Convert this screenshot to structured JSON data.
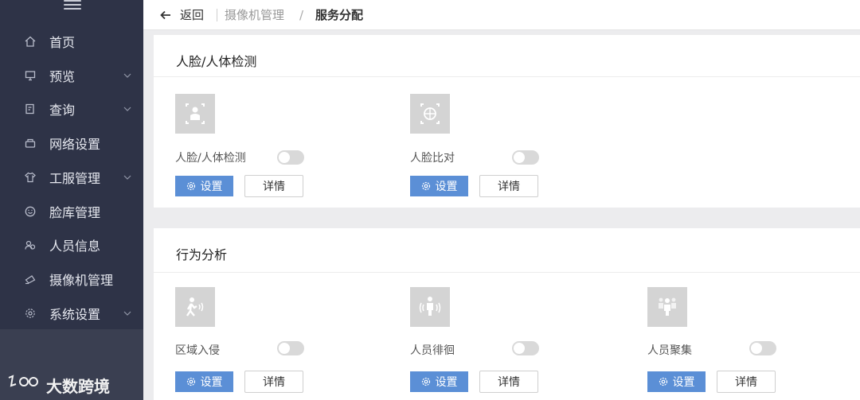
{
  "sidebar": {
    "items": [
      {
        "label": "首页",
        "icon": "home-icon",
        "expandable": false
      },
      {
        "label": "预览",
        "icon": "monitor-icon",
        "expandable": true
      },
      {
        "label": "查询",
        "icon": "document-search-icon",
        "expandable": true
      },
      {
        "label": "网络设置",
        "icon": "network-icon",
        "expandable": false
      },
      {
        "label": "工服管理",
        "icon": "shirt-icon",
        "expandable": true
      },
      {
        "label": "脸库管理",
        "icon": "smile-icon",
        "expandable": false
      },
      {
        "label": "人员信息",
        "icon": "people-icon",
        "expandable": false
      },
      {
        "label": "摄像机管理",
        "icon": "camera-icon",
        "expandable": false
      },
      {
        "label": "系统设置",
        "icon": "settings-icon",
        "expandable": true
      }
    ],
    "brand": "大数跨境"
  },
  "topbar": {
    "back_label": "返回",
    "breadcrumb": [
      "摄像机管理",
      "服务分配"
    ],
    "separator": "/"
  },
  "sections": [
    {
      "title": "人脸/人体检测",
      "services": [
        {
          "label": "人脸/人体检测",
          "icon": "face-body-detect-icon",
          "enabled": false,
          "set_label": "设置",
          "detail_label": "详情"
        },
        {
          "label": "人脸比对",
          "icon": "face-compare-icon",
          "enabled": false,
          "set_label": "设置",
          "detail_label": "详情"
        }
      ]
    },
    {
      "title": "行为分析",
      "services": [
        {
          "label": "区域入侵",
          "icon": "area-intrusion-icon",
          "enabled": false,
          "set_label": "设置",
          "detail_label": "详情"
        },
        {
          "label": "人员徘徊",
          "icon": "loitering-icon",
          "enabled": false,
          "set_label": "设置",
          "detail_label": "详情"
        },
        {
          "label": "人员聚集",
          "icon": "crowd-icon",
          "enabled": false,
          "set_label": "设置",
          "detail_label": "详情"
        }
      ]
    }
  ],
  "colors": {
    "sidebar_bg": "#2e3347",
    "primary_button": "#5b8fd6",
    "toggle_off": "#d9d9d9",
    "page_bg": "#ececee"
  }
}
